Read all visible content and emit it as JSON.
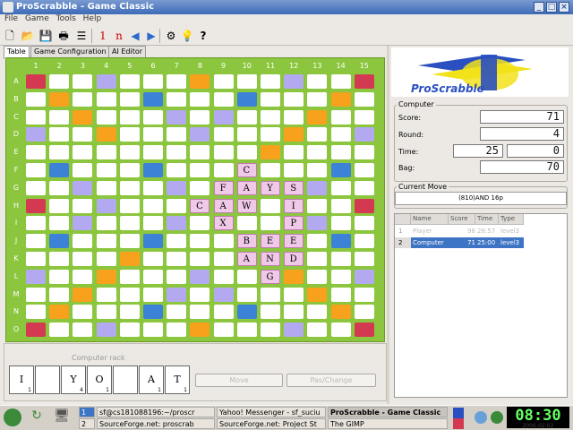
{
  "window": {
    "title": "ProScrabble - Game Classic",
    "buttons": [
      "_",
      "□",
      "×"
    ]
  },
  "menubar": [
    "File",
    "Game",
    "Tools",
    "Help"
  ],
  "tabs": [
    "Table",
    "Game Configuration",
    "AI Editor"
  ],
  "board": {
    "columns": [
      "1",
      "2",
      "3",
      "4",
      "5",
      "6",
      "7",
      "8",
      "9",
      "10",
      "11",
      "12",
      "13",
      "14",
      "15"
    ],
    "rows": [
      "A",
      "B",
      "C",
      "D",
      "E",
      "F",
      "G",
      "H",
      "I",
      "J",
      "K",
      "L",
      "M",
      "N",
      "O"
    ],
    "placed_tiles": [
      {
        "row": "F",
        "col": "10",
        "letter": "C"
      },
      {
        "row": "G",
        "col": "9",
        "letter": "F"
      },
      {
        "row": "G",
        "col": "10",
        "letter": "A"
      },
      {
        "row": "G",
        "col": "11",
        "letter": "Y"
      },
      {
        "row": "G",
        "col": "12",
        "letter": "S"
      },
      {
        "row": "H",
        "col": "8",
        "letter": "C"
      },
      {
        "row": "H",
        "col": "9",
        "letter": "A"
      },
      {
        "row": "H",
        "col": "10",
        "letter": "W"
      },
      {
        "row": "H",
        "col": "12",
        "letter": "I"
      },
      {
        "row": "I",
        "col": "9",
        "letter": "X"
      },
      {
        "row": "I",
        "col": "12",
        "letter": "P"
      },
      {
        "row": "J",
        "col": "10",
        "letter": "B"
      },
      {
        "row": "J",
        "col": "11",
        "letter": "E"
      },
      {
        "row": "J",
        "col": "12",
        "letter": "E"
      },
      {
        "row": "K",
        "col": "10",
        "letter": "A"
      },
      {
        "row": "K",
        "col": "11",
        "letter": "N"
      },
      {
        "row": "K",
        "col": "12",
        "letter": "D"
      },
      {
        "row": "L",
        "col": "11",
        "letter": "G"
      }
    ]
  },
  "rack": {
    "label": "Computer rack",
    "tiles": [
      {
        "letter": "I",
        "value": "1"
      },
      {
        "letter": "",
        "value": ""
      },
      {
        "letter": "Y",
        "value": "4"
      },
      {
        "letter": "O",
        "value": "1"
      },
      {
        "letter": "",
        "value": ""
      },
      {
        "letter": "A",
        "value": "1"
      },
      {
        "letter": "T",
        "value": "1"
      }
    ],
    "move_button": "Move",
    "pass_button": "Pas/Change"
  },
  "logo_text": "ProScrabble",
  "computer_panel": {
    "title": "Computer",
    "score_label": "Score:",
    "score": "71",
    "round_label": "Round:",
    "round": "4",
    "time_label": "Time:",
    "time_a": "25",
    "time_b": "0",
    "bag_label": "Bag:",
    "bag": "70"
  },
  "current_move": {
    "title": "Current Move",
    "text": "(810)AND 16p"
  },
  "players_table": {
    "headers": [
      "Name",
      "Score",
      "Time",
      "Type"
    ],
    "rows": [
      {
        "num": "1",
        "name": "Player",
        "score": "98",
        "time": "28:57",
        "type": "level3"
      },
      {
        "num": "2",
        "name": "Computer",
        "score": "71",
        "time": "25:00",
        "type": "level3"
      }
    ]
  },
  "taskbar": {
    "workspaces": [
      "1",
      "2"
    ],
    "tasks": [
      "sf@cs181088196:~/proscr",
      "Yahoo! Messenger - sf_suciu",
      "ProScrabble - Game Classic",
      "SourceForge.net: proscrab",
      "SourceForge.net: Project St",
      "The GIMP"
    ],
    "clock": "08:30",
    "date": "2006-02-02"
  },
  "colors": {
    "board": "#8cc63f",
    "double_word": "#b3a9f0",
    "triple_word": "#d33a52",
    "double_letter": "#f7a11c",
    "triple_letter": "#3c82d6",
    "tile": "#f0c8e8",
    "selection": "#3d74c4"
  }
}
